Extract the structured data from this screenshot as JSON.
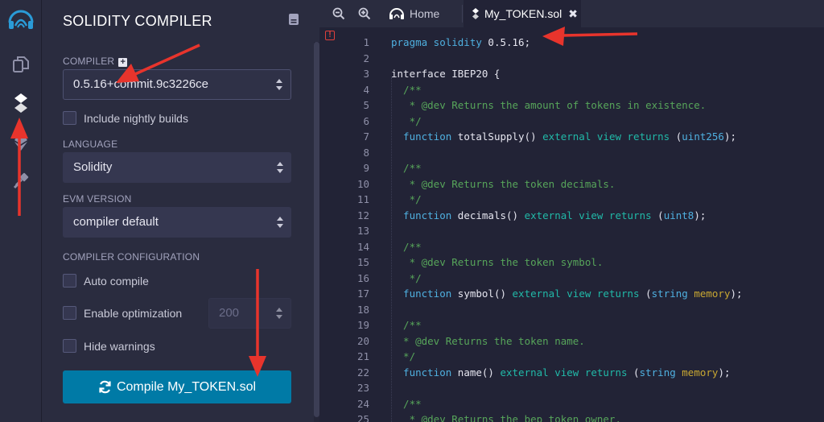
{
  "rail": {
    "icons": [
      "remix-logo-icon",
      "file-explorer-icon",
      "solidity-compiler-icon",
      "deploy-run-icon",
      "plugin-manager-icon"
    ],
    "accent": "#2a9bd7"
  },
  "panel": {
    "title": "SOLIDITY COMPILER",
    "compiler_label": "COMPILER",
    "compiler_value": "0.5.16+commit.9c3226ce",
    "nightly_label": "Include nightly builds",
    "language_label": "LANGUAGE",
    "language_value": "Solidity",
    "evm_label": "EVM VERSION",
    "evm_value": "compiler default",
    "config_label": "COMPILER CONFIGURATION",
    "auto_compile_label": "Auto compile",
    "optimization_label": "Enable optimization",
    "runs_value": "200",
    "hide_warnings_label": "Hide warnings",
    "compile_button": "Compile My_TOKEN.sol"
  },
  "tabs": {
    "home": "Home",
    "file": "My_TOKEN.sol",
    "close": "✖"
  },
  "editor": {
    "error_marker": "!",
    "lines": [
      {
        "n": "1",
        "parts": [
          [
            "pragma solidity",
            "#4fb0e0"
          ],
          [
            " 0.5.16;",
            "#e6e6f0"
          ]
        ]
      },
      {
        "n": "2",
        "parts": []
      },
      {
        "n": "3",
        "parts": [
          [
            "interface IBEP20 {",
            "#e6e6f0"
          ]
        ]
      },
      {
        "n": "4",
        "parts": [
          [
            "  /**",
            "#57a55a"
          ]
        ]
      },
      {
        "n": "5",
        "parts": [
          [
            "   * @dev Returns the amount of tokens in existence.",
            "#57a55a"
          ]
        ]
      },
      {
        "n": "6",
        "parts": [
          [
            "   */",
            "#57a55a"
          ]
        ]
      },
      {
        "n": "7",
        "parts": [
          [
            "  function",
            "#4fb0e0"
          ],
          [
            " totalSupply() ",
            "#e6e6f0"
          ],
          [
            "external view returns",
            "#21b9a8"
          ],
          [
            " (",
            "#e6e6f0"
          ],
          [
            "uint256",
            "#4fb0e0"
          ],
          [
            ");",
            "#e6e6f0"
          ]
        ]
      },
      {
        "n": "8",
        "parts": []
      },
      {
        "n": "9",
        "parts": [
          [
            "  /**",
            "#57a55a"
          ]
        ]
      },
      {
        "n": "10",
        "parts": [
          [
            "   * @dev Returns the token decimals.",
            "#57a55a"
          ]
        ]
      },
      {
        "n": "11",
        "parts": [
          [
            "   */",
            "#57a55a"
          ]
        ]
      },
      {
        "n": "12",
        "parts": [
          [
            "  function",
            "#4fb0e0"
          ],
          [
            " decimals() ",
            "#e6e6f0"
          ],
          [
            "external view returns",
            "#21b9a8"
          ],
          [
            " (",
            "#e6e6f0"
          ],
          [
            "uint8",
            "#4fb0e0"
          ],
          [
            ");",
            "#e6e6f0"
          ]
        ]
      },
      {
        "n": "13",
        "parts": []
      },
      {
        "n": "14",
        "parts": [
          [
            "  /**",
            "#57a55a"
          ]
        ]
      },
      {
        "n": "15",
        "parts": [
          [
            "   * @dev Returns the token symbol.",
            "#57a55a"
          ]
        ]
      },
      {
        "n": "16",
        "parts": [
          [
            "   */",
            "#57a55a"
          ]
        ]
      },
      {
        "n": "17",
        "parts": [
          [
            "  function",
            "#4fb0e0"
          ],
          [
            " symbol() ",
            "#e6e6f0"
          ],
          [
            "external view returns",
            "#21b9a8"
          ],
          [
            " (",
            "#e6e6f0"
          ],
          [
            "string",
            "#4fb0e0"
          ],
          [
            " ",
            "#e6e6f0"
          ],
          [
            "memory",
            "#c8a732"
          ],
          [
            ");",
            "#e6e6f0"
          ]
        ]
      },
      {
        "n": "18",
        "parts": []
      },
      {
        "n": "19",
        "parts": [
          [
            "  /**",
            "#57a55a"
          ]
        ]
      },
      {
        "n": "20",
        "parts": [
          [
            "  * @dev Returns the token name.",
            "#57a55a"
          ]
        ]
      },
      {
        "n": "21",
        "parts": [
          [
            "  */",
            "#57a55a"
          ]
        ]
      },
      {
        "n": "22",
        "parts": [
          [
            "  function",
            "#4fb0e0"
          ],
          [
            " name() ",
            "#e6e6f0"
          ],
          [
            "external view returns",
            "#21b9a8"
          ],
          [
            " (",
            "#e6e6f0"
          ],
          [
            "string",
            "#4fb0e0"
          ],
          [
            " ",
            "#e6e6f0"
          ],
          [
            "memory",
            "#c8a732"
          ],
          [
            ");",
            "#e6e6f0"
          ]
        ]
      },
      {
        "n": "23",
        "parts": []
      },
      {
        "n": "24",
        "parts": [
          [
            "  /**",
            "#57a55a"
          ]
        ]
      },
      {
        "n": "25",
        "parts": [
          [
            "   * @dev Returns the bep token owner.",
            "#57a55a"
          ]
        ]
      }
    ]
  }
}
